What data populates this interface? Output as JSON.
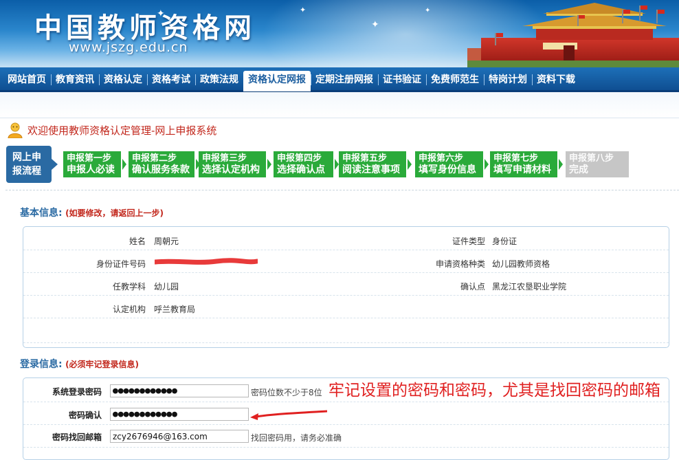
{
  "header": {
    "site_title": "中国教师资格网",
    "site_url": "www.jszg.edu.cn"
  },
  "nav": {
    "items": [
      {
        "label": "网站首页"
      },
      {
        "label": "教育资讯"
      },
      {
        "label": "资格认定"
      },
      {
        "label": "资格考试"
      },
      {
        "label": "政策法规"
      },
      {
        "label": "资格认定网报",
        "active": true
      },
      {
        "label": "定期注册网报"
      },
      {
        "label": "证书验证"
      },
      {
        "label": "免费师范生"
      },
      {
        "label": "特岗计划"
      },
      {
        "label": "资料下载"
      }
    ]
  },
  "welcome": {
    "text": "欢迎使用教师资格认定管理-网上申报系统",
    "icon": "user-icon"
  },
  "flow": {
    "label_line1": "网上申",
    "label_line2": "报流程",
    "steps": [
      {
        "line1": "申报第一步",
        "line2": "申报人必读"
      },
      {
        "line1": "申报第二步",
        "line2": "确认服务条款"
      },
      {
        "line1": "申报第三步",
        "line2": "选择认定机构"
      },
      {
        "line1": "申报第四步",
        "line2": "选择确认点"
      },
      {
        "line1": "申报第五步",
        "line2": "阅读注意事项"
      },
      {
        "line1": "申报第六步",
        "line2": "填写身份信息"
      },
      {
        "line1": "申报第七步",
        "line2": "填写申请材料"
      },
      {
        "line1": "申报第八步",
        "line2": "完成",
        "disabled": true
      }
    ],
    "active_color": "#2aaa3a",
    "disabled_color": "#c6c6c6"
  },
  "basic_info": {
    "title": "基本信息:",
    "note": "(如要修改，请返回上一步)",
    "name_label": "姓名",
    "name_value": "周朝元",
    "cert_type_label": "证件类型",
    "cert_type_value": "身份证",
    "id_label": "身份证件号码",
    "qual_type_label": "申请资格种类",
    "qual_type_value": "幼儿园教师资格",
    "subject_label": "任教学科",
    "subject_value": "幼儿园",
    "confirm_point_label": "确认点",
    "confirm_point_value": "黑龙江农垦职业学院",
    "agency_label": "认定机构",
    "agency_value": "呼兰教育局"
  },
  "login_info": {
    "title": "登录信息:",
    "note": "(必须牢记登录信息)",
    "password_label": "系统登录密码",
    "password_value": "●●●●●●●●●●●●",
    "password_hint": "密码位数不少于8位",
    "confirm_label": "密码确认",
    "confirm_value": "●●●●●●●●●●●●",
    "email_label": "密码找回邮箱",
    "email_value": "zcy2676946@163.com",
    "email_hint": "找回密码用，请务必准确"
  },
  "annotation": {
    "text": "牢记设置的密码和密码，尤其是找回密码的邮箱",
    "color": "#e02020"
  }
}
